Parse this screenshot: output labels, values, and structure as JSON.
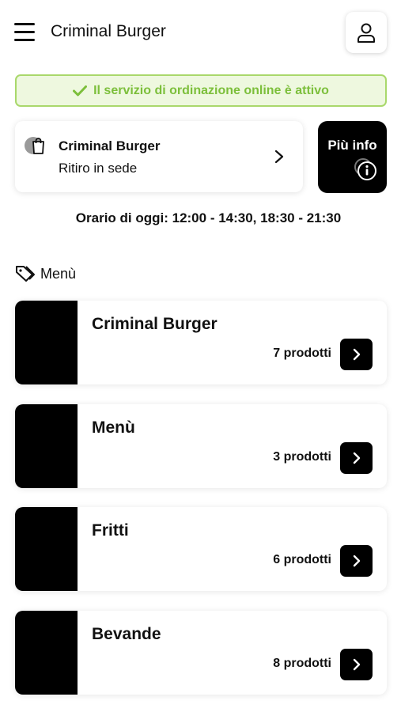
{
  "header": {
    "title": "Criminal Burger",
    "menu_icon": "hamburger-icon",
    "profile_icon": "user-icon"
  },
  "status": {
    "text": "Il servizio di ordinazione online è attivo",
    "icon": "check-icon",
    "color": "#7cbf3b"
  },
  "store": {
    "name": "Criminal Burger",
    "mode": "Ritiro in sede",
    "icon": "shopping-bag-icon"
  },
  "info_button": {
    "label": "Più info",
    "icon": "info-icon"
  },
  "hours": "Orario di oggi: 12:00 - 14:30, 18:30 - 21:30",
  "section": {
    "label": "Menù",
    "icon": "tag-icon"
  },
  "categories": [
    {
      "name": "Criminal Burger",
      "count": "7 prodotti"
    },
    {
      "name": "Menù",
      "count": "3 prodotti"
    },
    {
      "name": "Fritti",
      "count": "6 prodotti"
    },
    {
      "name": "Bevande",
      "count": "8 prodotti"
    }
  ]
}
